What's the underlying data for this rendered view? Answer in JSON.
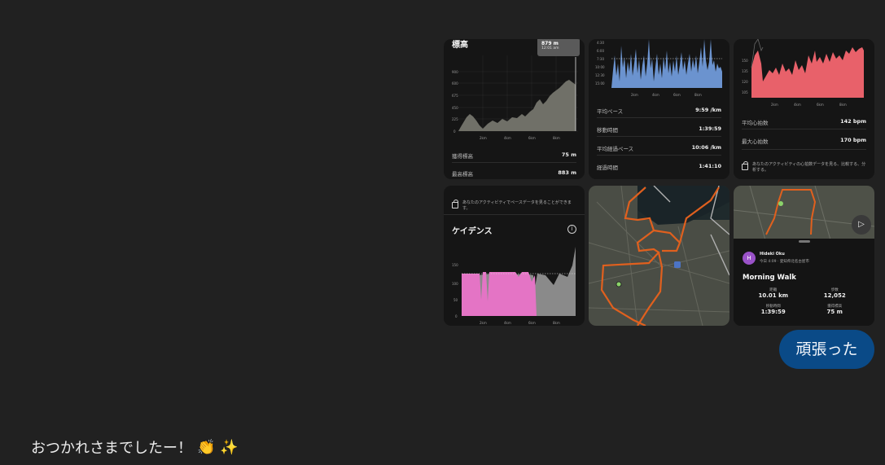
{
  "colors": {
    "background": "#212121",
    "card": "#151515",
    "elevation_fill": "#707068",
    "pace_fill": "#6b93cf",
    "heart_fill": "#e8616a",
    "cadence_fill": "#e474c5",
    "route": "#e0601e",
    "bubble": "#0a4a87"
  },
  "elevation": {
    "title": "標高",
    "tooltip_value": "879 m",
    "tooltip_sub": "12:01 am",
    "y_ticks": [
      "900",
      "600",
      "675",
      "450",
      "225",
      "0"
    ],
    "x_ticks": [
      "2km",
      "4km",
      "6km",
      "8km"
    ],
    "stat1_label": "獲得標高",
    "stat1_value": "75 m",
    "stat2_label": "最高標高",
    "stat2_value": "883 m"
  },
  "pace": {
    "y_ticks": [
      "4:30",
      "6:00",
      "7:30",
      "10:00",
      "12:30",
      "15:00"
    ],
    "x_ticks": [
      "2km",
      "4km",
      "6km",
      "8km"
    ],
    "rows": [
      {
        "label": "平均ペース",
        "value": "9:59 /km"
      },
      {
        "label": "移動時間",
        "value": "1:39:59"
      },
      {
        "label": "平均経過ペース",
        "value": "10:06 /km"
      },
      {
        "label": "経過時間",
        "value": "1:41:10"
      }
    ]
  },
  "heart": {
    "y_ticks": [
      "150",
      "135",
      "120",
      "105"
    ],
    "x_ticks": [
      "2km",
      "4km",
      "6km",
      "8km"
    ],
    "rows": [
      {
        "label": "平均心拍数",
        "value": "142 bpm"
      },
      {
        "label": "最大心拍数",
        "value": "170 bpm"
      }
    ],
    "lock_text": "あなたのアクティビティの心拍数データを見る、比較する、分析する。"
  },
  "cadence": {
    "lock_text": "あなたのアクティビティでペースデータを見ることができます。",
    "title": "ケイデンス",
    "y_ticks": [
      "150",
      "100",
      "50",
      "0"
    ],
    "x_ticks": [
      "2km",
      "4km",
      "6km",
      "8km"
    ]
  },
  "activity": {
    "avatar": "H",
    "user": "Hideki Oku",
    "sub": "今日 4:09 · 愛知県北名古屋市",
    "name": "Morning Walk",
    "stats": [
      {
        "label": "距離",
        "value": "10.01 km"
      },
      {
        "label": "歩数",
        "value": "12,052"
      },
      {
        "label": "移動時間",
        "value": "1:39:59"
      },
      {
        "label": "獲得標高",
        "value": "75 m"
      }
    ]
  },
  "chat": {
    "user_bubble": "頑張った",
    "reply_text": "おつかれさまでしたー！",
    "reply_emoji_1": "👏",
    "reply_emoji_2": "✨"
  }
}
